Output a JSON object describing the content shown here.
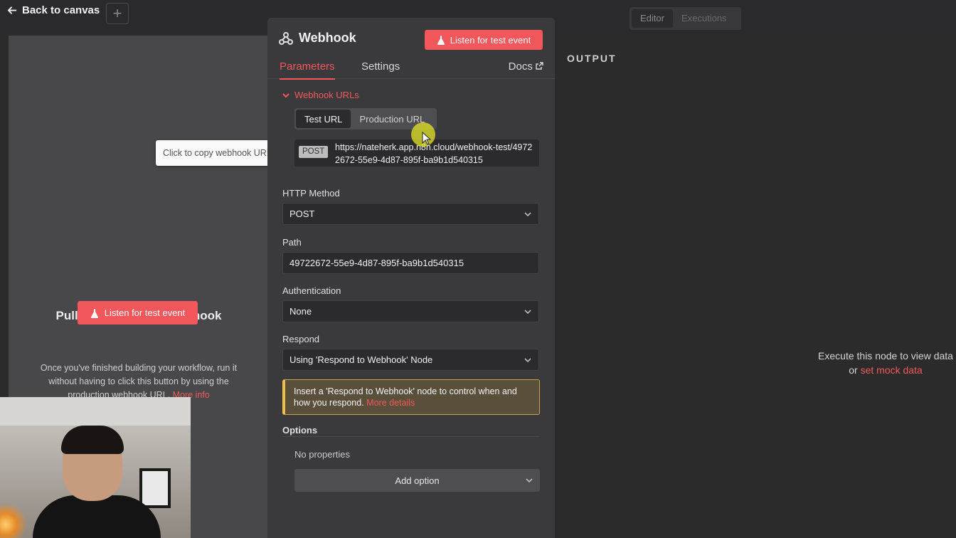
{
  "topbar": {
    "back_label": "Back to canvas",
    "add_label": "+",
    "modes": [
      "Editor",
      "Executions"
    ],
    "active_mode": "Editor"
  },
  "input_panel": {
    "title": "Pull in events from Webhook",
    "listen_label": "Listen for test event",
    "hint": "Once you've finished building your workflow, run it without having to click this button by using the production webhook URL.",
    "hint_link": "More info"
  },
  "tooltip": "Click to copy webhook URLs",
  "node": {
    "name": "Webhook",
    "listen_label": "Listen for test event",
    "tabs": [
      "Parameters",
      "Settings"
    ],
    "active_tab": "Parameters",
    "docs_label": "Docs",
    "webhook_urls": {
      "section_label": "Webhook URLs",
      "url_tabs": [
        "Test URL",
        "Production URL"
      ],
      "active_url_tab": "Test URL",
      "method": "POST",
      "url": "https://nateherk.app.n8n.cloud/webhook-test/49722672-55e9-4d87-895f-ba9b1d540315"
    },
    "fields": {
      "http_method": {
        "label": "HTTP Method",
        "value": "POST"
      },
      "path": {
        "label": "Path",
        "value": "49722672-55e9-4d87-895f-ba9b1d540315"
      },
      "authentication": {
        "label": "Authentication",
        "value": "None"
      },
      "respond": {
        "label": "Respond",
        "value": "Using 'Respond to Webhook' Node"
      }
    },
    "notice": {
      "text": "Insert a 'Respond to Webhook' node to control when and how you respond.",
      "link": "More details"
    },
    "options": {
      "label": "Options",
      "empty": "No properties",
      "add_label": "Add option"
    }
  },
  "output": {
    "title": "OUTPUT",
    "message": "Execute this node to view data",
    "message_prefix": "or",
    "message_link": "set mock data"
  },
  "colors": {
    "accent": "#f2585b",
    "notice_border": "#f0c048"
  },
  "icons": {
    "back": "arrow-left-icon",
    "webhook": "webhook-icon",
    "flask": "flask-icon",
    "external": "external-link-icon",
    "chevron": "chevron-down-icon"
  }
}
